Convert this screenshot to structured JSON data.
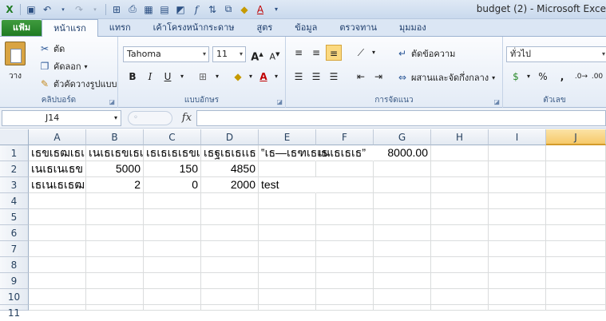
{
  "window": {
    "title": "budget (2)  -  Microsoft Exce"
  },
  "quick_access": [
    "save-icon",
    "undo-icon",
    "redo-icon",
    "borders-icon",
    "print-preview-icon",
    "table-icon",
    "chart-icon",
    "fx-icon",
    "merge-icon",
    "fill-color-icon",
    "font-color-icon"
  ],
  "tabs": [
    "แฟ้ม",
    "หน้าแรก",
    "แทรก",
    "เค้าโครงหน้ากระดาษ",
    "สูตร",
    "ข้อมูล",
    "ตรวจทาน",
    "มุมมอง"
  ],
  "active_tab_index": 1,
  "clipboard": {
    "paste_label": "วาง",
    "cut_label": "ตัด",
    "copy_label": "คัดลอก",
    "format_painter_label": "ตัวคัดวางรูปแบบ",
    "group_label": "คลิปบอร์ด"
  },
  "font": {
    "name": "Tahoma",
    "size": "11",
    "group_label": "แบบอักษร",
    "bold": "B",
    "italic": "I",
    "underline": "U"
  },
  "alignment": {
    "wrap_label": "ตัดข้อความ",
    "merge_label": "ผสานและจัดกึ่งกลาง",
    "group_label": "การจัดแนว"
  },
  "number": {
    "format": "ทั่วไป",
    "group_label": "ตัวเลข",
    "percent": "%",
    "comma": ","
  },
  "formula_bar": {
    "name_box": "J14",
    "fx_label": "fx",
    "value": ""
  },
  "sheet": {
    "columns": [
      "A",
      "B",
      "C",
      "D",
      "E",
      "F",
      "G",
      "H",
      "I",
      "J"
    ],
    "selected_column": "J",
    "rows": [
      "1",
      "2",
      "3",
      "4",
      "5",
      "6",
      "7",
      "8",
      "9",
      "10",
      "11"
    ],
    "cells": {
      "A1": "เธขเธฒเธเเธข",
      "B1": "เนเธเธขเธเเ",
      "C1": "เธเธเธเธขเธ",
      "D1": "เธฐเธเธเเธ",
      "E1": "‟เธ—เธฑเธเธ",
      "F1": "เนเธเธเธ”",
      "G1": "8000.00",
      "A2": "เนเธเนเธข",
      "B2": "5000",
      "C2": "150",
      "D2": "4850",
      "A3": "เธเนเธเธฒเธ",
      "B3": "2",
      "C3": "0",
      "D3": "2000",
      "E3": "test"
    }
  },
  "colors": {
    "file_tab": "#2a8a2e",
    "ribbon_bg": "#e3ebf6",
    "selected_col": "#f6c96a"
  }
}
